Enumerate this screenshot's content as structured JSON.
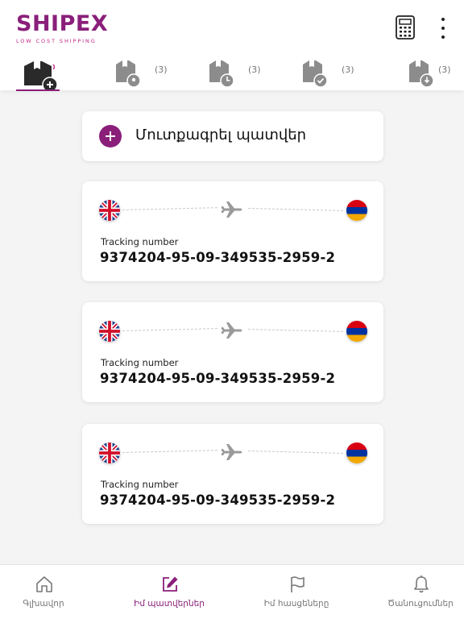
{
  "app": {
    "logo_text": "SHIPEX",
    "logo_tagline": "LOW COST SHIPPING"
  },
  "header": {
    "calculator_icon": "calculator-icon",
    "more_icon": "more-vertical-icon"
  },
  "tabs": [
    {
      "icon": "package-add-icon",
      "count": "",
      "active": true
    },
    {
      "icon": "package-location-icon",
      "count": "(3)"
    },
    {
      "icon": "package-clock-icon",
      "count": "(3)"
    },
    {
      "icon": "package-check-icon",
      "count": "(3)"
    },
    {
      "icon": "package-download-icon",
      "count": "(3)"
    }
  ],
  "add_order": {
    "label": "Մուտքագրել պատվեր"
  },
  "orders": [
    {
      "from_flag": "uk-flag-icon",
      "to_flag": "armenia-flag-icon",
      "tracking_label": "Tracking number",
      "tracking_number": "9374204-95-09-349535-2959-2"
    },
    {
      "from_flag": "uk-flag-icon",
      "to_flag": "armenia-flag-icon",
      "tracking_label": "Tracking number",
      "tracking_number": "9374204-95-09-349535-2959-2"
    },
    {
      "from_flag": "uk-flag-icon",
      "to_flag": "armenia-flag-icon",
      "tracking_label": "Tracking number",
      "tracking_number": "9374204-95-09-349535-2959-2"
    }
  ],
  "bottom_nav": [
    {
      "label": "Գլխավոր",
      "icon": "home-icon"
    },
    {
      "label": "Իմ պատվերներ",
      "icon": "edit-icon",
      "active": true
    },
    {
      "label": "Իմ հասցեները",
      "icon": "flag-icon"
    },
    {
      "label": "Ծանուցումներ",
      "icon": "bell-icon"
    }
  ],
  "colors": {
    "brand": "#8a1f7a",
    "brand_light": "#c0288a",
    "muted": "#777777",
    "background": "#f4f4f4"
  }
}
